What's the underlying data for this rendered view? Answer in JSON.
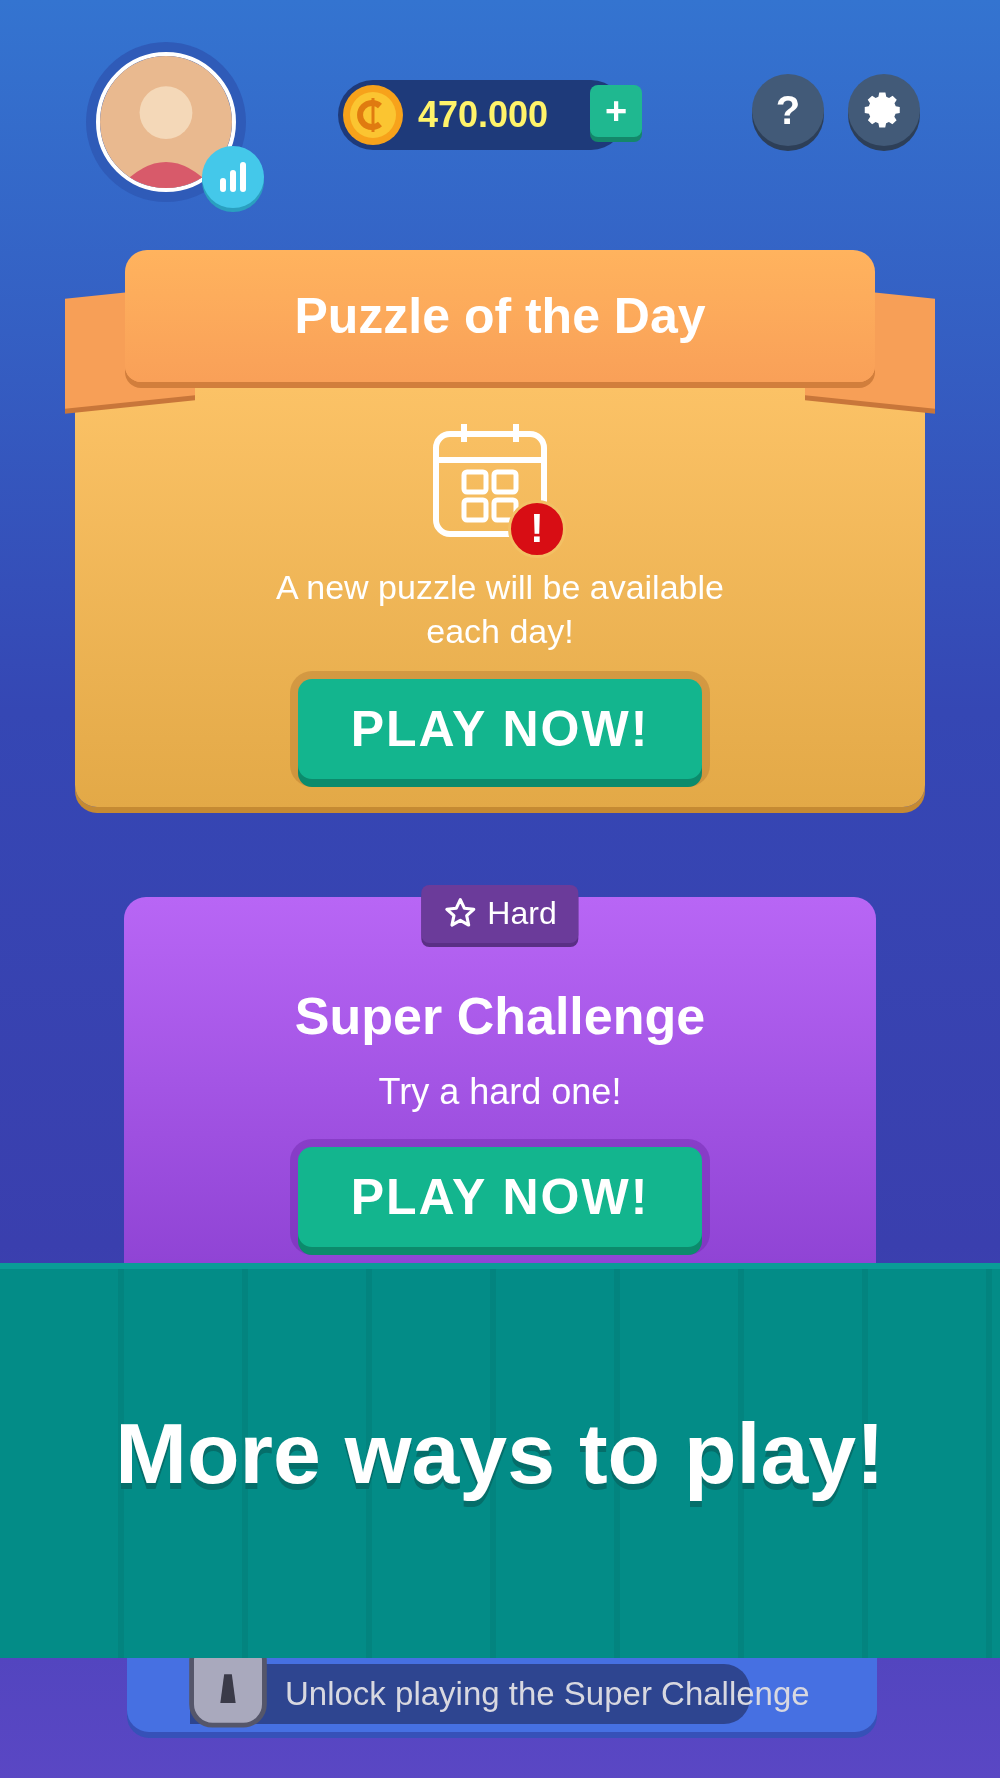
{
  "header": {
    "coins": "470.000",
    "add_label": "+",
    "help_label": "?"
  },
  "daily": {
    "title": "Puzzle of the Day",
    "message": "A new puzzle will be available each day!",
    "alert": "!",
    "button": "PLAY NOW!"
  },
  "challenge": {
    "badge": "Hard",
    "title": "Super Challenge",
    "subtitle": "Try a hard one!",
    "button": "PLAY NOW!"
  },
  "banner": {
    "text": "More ways to play!"
  },
  "unlock": {
    "text": "Unlock playing the Super Challenge"
  }
}
